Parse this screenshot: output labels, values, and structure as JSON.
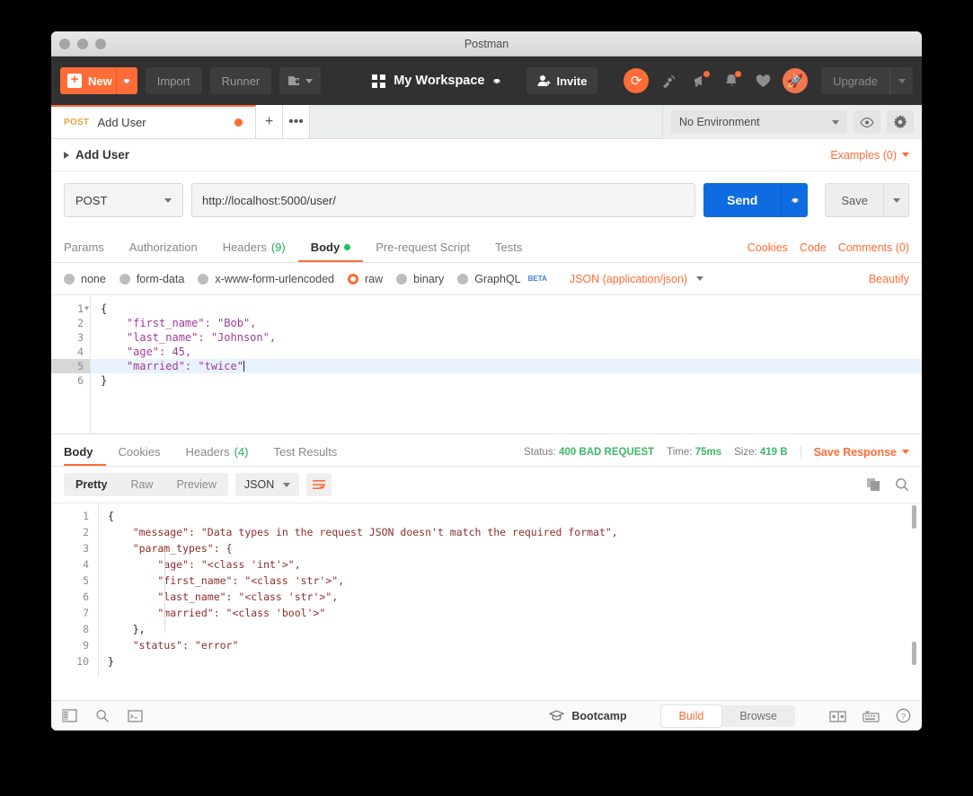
{
  "window": {
    "title": "Postman"
  },
  "toolbar": {
    "new_label": "New",
    "import_label": "Import",
    "runner_label": "Runner",
    "workspace_label": "My Workspace",
    "invite_label": "Invite",
    "upgrade_label": "Upgrade",
    "icons": [
      "sync-icon",
      "satellite-icon",
      "megaphone-icon",
      "bell-icon",
      "heart-icon",
      "rocket-icon"
    ]
  },
  "tabs": {
    "request_tab": {
      "method": "POST",
      "name": "Add User",
      "unsaved": true
    },
    "new_tab_label": "+",
    "more_label": "•••"
  },
  "environment": {
    "selected": "No Environment",
    "eye_icon": "eye-icon",
    "settings_icon": "gear-icon"
  },
  "request": {
    "name": "Add User",
    "examples_label": "Examples (0)",
    "method": "POST",
    "url": "http://localhost:5000/user/",
    "send_label": "Send",
    "save_label": "Save",
    "tabs": [
      {
        "label": "Params",
        "active": false
      },
      {
        "label": "Authorization",
        "active": false
      },
      {
        "label": "Headers",
        "count": "(9)",
        "active": false
      },
      {
        "label": "Body",
        "active": true,
        "dot": true
      },
      {
        "label": "Pre-request Script",
        "active": false
      },
      {
        "label": "Tests",
        "active": false
      }
    ],
    "links": [
      "Cookies",
      "Code",
      "Comments (0)"
    ],
    "body_types": [
      {
        "label": "none",
        "selected": false
      },
      {
        "label": "form-data",
        "selected": false
      },
      {
        "label": "x-www-form-urlencoded",
        "selected": false
      },
      {
        "label": "raw",
        "selected": true
      },
      {
        "label": "binary",
        "selected": false
      },
      {
        "label": "GraphQL",
        "selected": false,
        "badge": "BETA"
      }
    ],
    "content_type": "JSON (application/json)",
    "beautify_label": "Beautify",
    "body_lines": [
      {
        "n": "1",
        "fold": true,
        "text": "{"
      },
      {
        "n": "2",
        "text": "    \"first_name\": \"Bob\","
      },
      {
        "n": "3",
        "text": "    \"last_name\": \"Johnson\","
      },
      {
        "n": "4",
        "text": "    \"age\": 45,"
      },
      {
        "n": "5",
        "text": "    \"married\": \"twice\"",
        "highlight": true
      },
      {
        "n": "6",
        "text": "}"
      }
    ]
  },
  "response": {
    "tabs": [
      {
        "label": "Body",
        "active": true
      },
      {
        "label": "Cookies",
        "active": false
      },
      {
        "label": "Headers",
        "count": "(4)",
        "active": false
      },
      {
        "label": "Test Results",
        "active": false
      }
    ],
    "status_label": "Status:",
    "status_value": "400 BAD REQUEST",
    "time_label": "Time:",
    "time_value": "75ms",
    "size_label": "Size:",
    "size_value": "419 B",
    "save_response_label": "Save Response",
    "view_modes": [
      {
        "label": "Pretty",
        "active": true
      },
      {
        "label": "Raw",
        "active": false
      },
      {
        "label": "Preview",
        "active": false
      }
    ],
    "format": "JSON",
    "wrap_icon": "word-wrap-icon",
    "copy_icon": "copy-icon",
    "search_icon": "search-icon",
    "body_lines": [
      {
        "n": "1",
        "text": "{"
      },
      {
        "n": "2",
        "text": "    \"message\": \"Data types in the request JSON doesn't match the required format\","
      },
      {
        "n": "3",
        "text": "    \"param_types\": {"
      },
      {
        "n": "4",
        "text": "        \"age\": \"<class 'int'>\","
      },
      {
        "n": "5",
        "text": "        \"first_name\": \"<class 'str'>\","
      },
      {
        "n": "6",
        "text": "        \"last_name\": \"<class 'str'>\","
      },
      {
        "n": "7",
        "text": "        \"married\": \"<class 'bool'>\""
      },
      {
        "n": "8",
        "text": "    },"
      },
      {
        "n": "9",
        "text": "    \"status\": \"error\""
      },
      {
        "n": "10",
        "text": "}"
      }
    ]
  },
  "statusbar": {
    "left_icons": [
      "sidebar-toggle-icon",
      "find-icon",
      "console-icon"
    ],
    "bootcamp_label": "Bootcamp",
    "modes": [
      {
        "label": "Build",
        "active": true
      },
      {
        "label": "Browse",
        "active": false
      }
    ],
    "right_icons": [
      "two-pane-icon",
      "keyboard-shortcuts-icon",
      "help-icon"
    ]
  },
  "colors": {
    "accent": "#ff6c37",
    "send_blue": "#0f6ce0",
    "status_green": "#3bb768",
    "dark_chrome": "#313131"
  }
}
